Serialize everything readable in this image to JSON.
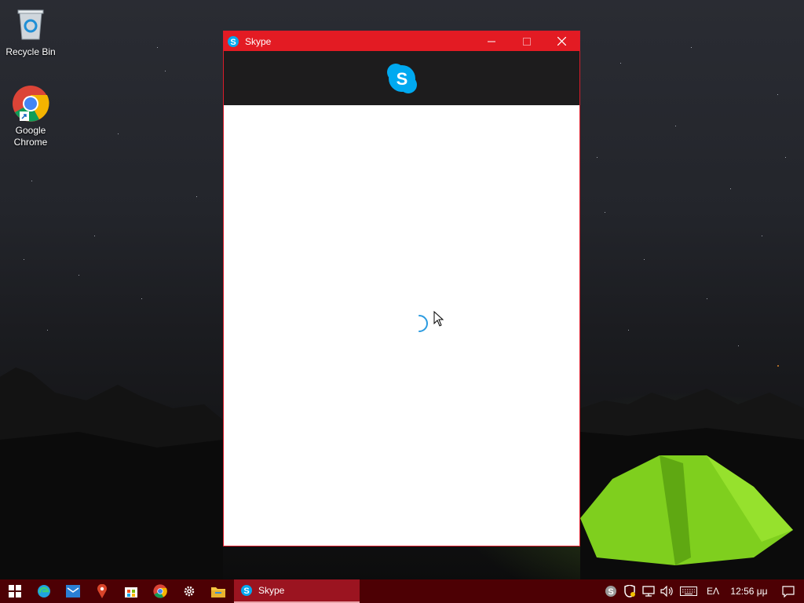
{
  "desktop": {
    "icons": [
      {
        "label": "Recycle Bin",
        "icon": "recycle-bin-icon"
      },
      {
        "label": "Google Chrome",
        "icon": "chrome-icon"
      }
    ]
  },
  "window": {
    "title": "Skype",
    "controls": [
      "minimize-icon",
      "maximize-icon",
      "close-icon"
    ],
    "accent": "#e31b23",
    "header_color": "#1d1c1d",
    "logo": "skype-logo-icon",
    "state": "loading-spinner"
  },
  "taskbar": {
    "color": "#4d0004",
    "pinned": [
      "start-icon",
      "edge-icon",
      "mail-icon",
      "maps-icon",
      "store-icon",
      "chrome-icon",
      "settings-icon",
      "file-explorer-icon"
    ],
    "active_app": {
      "label": "Skype",
      "icon": "skype-icon"
    },
    "tray": {
      "icons": [
        "skype-tray-icon",
        "security-icon",
        "network-icon",
        "volume-icon",
        "keyboard-icon"
      ],
      "language": "ΕΛ",
      "time": "12:56 μμ",
      "notifications_icon": "action-center-icon"
    }
  }
}
